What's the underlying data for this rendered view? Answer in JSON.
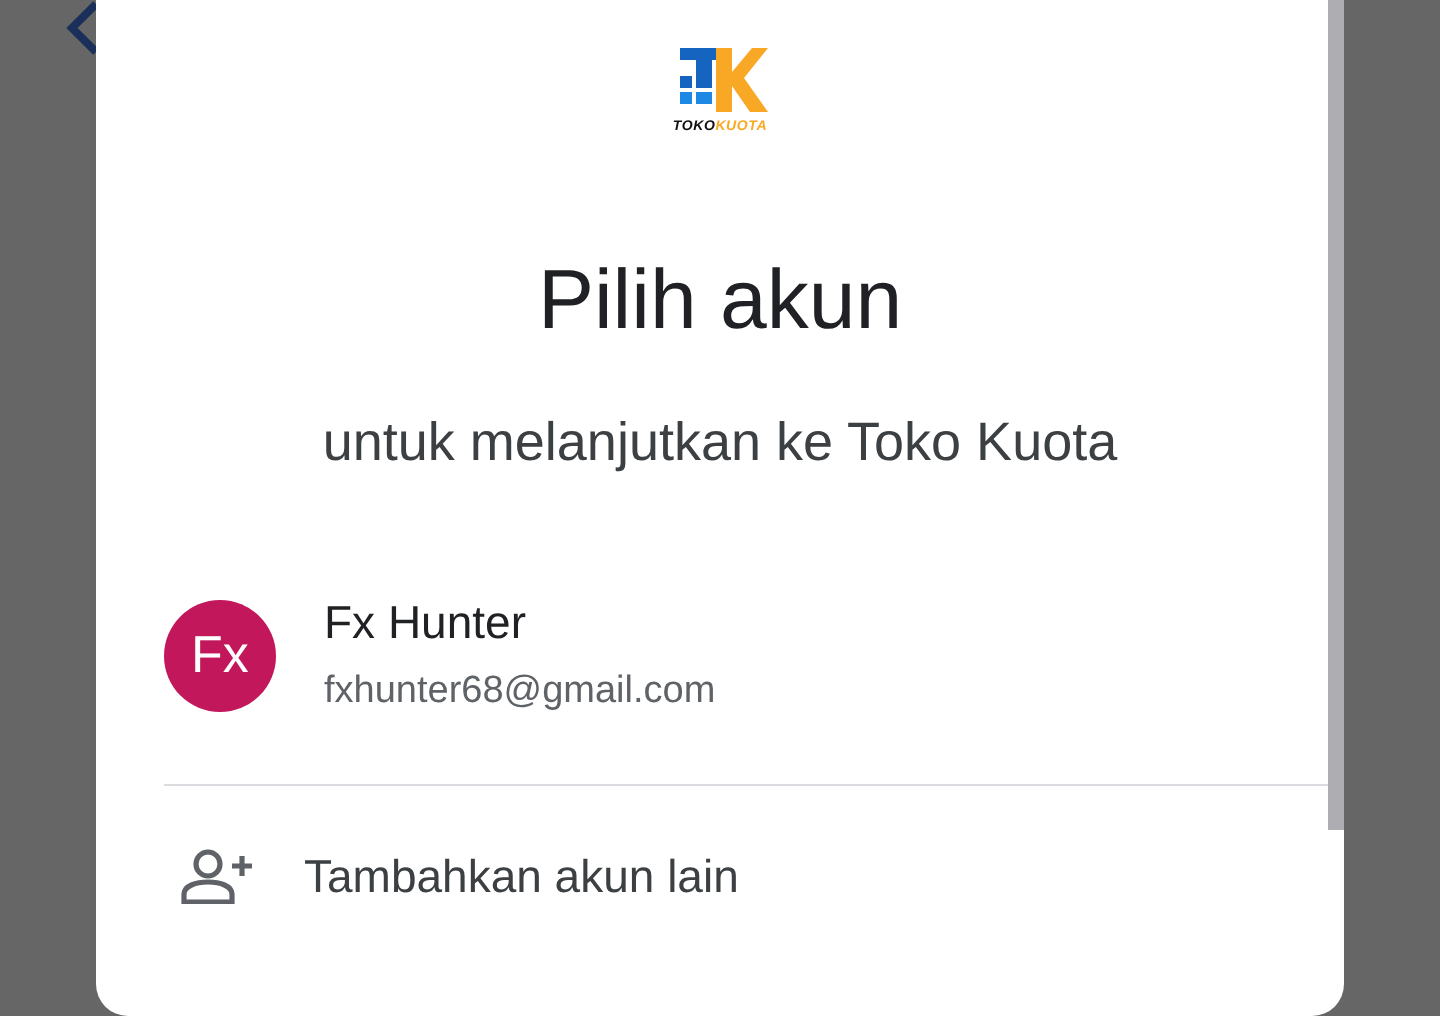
{
  "logo": {
    "text_dark": "TOKO",
    "text_accent": "KUOTA"
  },
  "title": "Pilih akun",
  "subtitle": "untuk melanjutkan ke Toko Kuota",
  "accounts": [
    {
      "initials": "Fx",
      "name": "Fx Hunter",
      "email": "fxhunter68@gmail.com",
      "color": "#c2185b"
    }
  ],
  "add_account": {
    "label": "Tambahkan akun lain"
  }
}
